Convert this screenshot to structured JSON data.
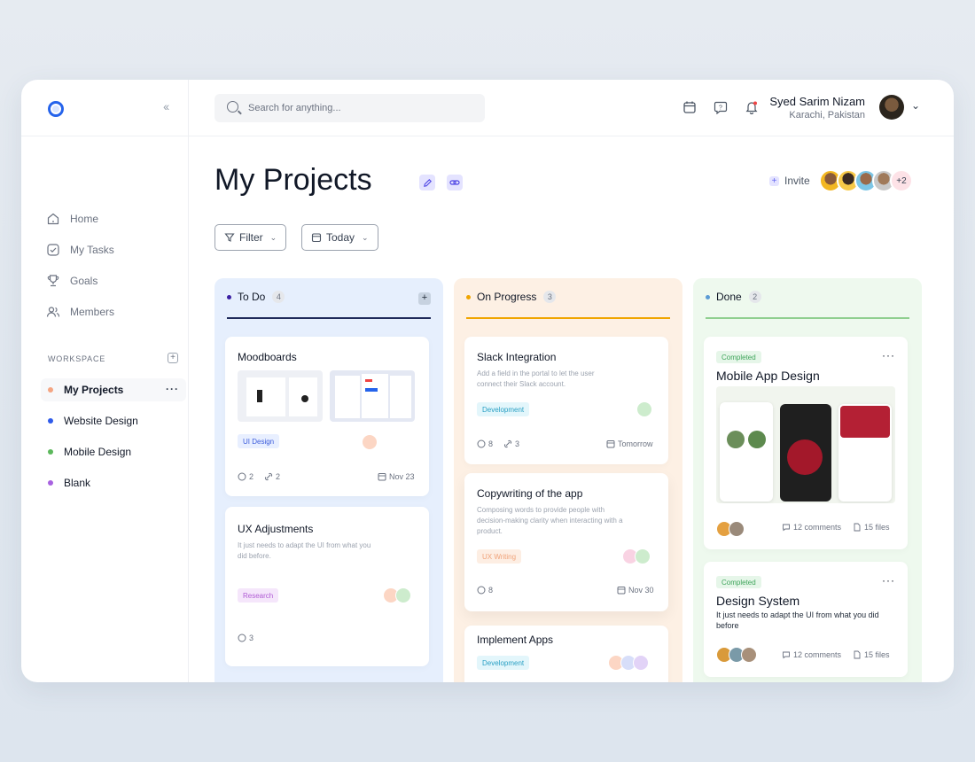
{
  "topbar": {
    "search_placeholder": "Search for anything...",
    "user_name": "Syed Sarim Nizam",
    "user_location": "Karachi, Pakistan"
  },
  "sidebar": {
    "nav": [
      {
        "label": "Home",
        "icon": "home-icon"
      },
      {
        "label": "My Tasks",
        "icon": "check-square-icon"
      },
      {
        "label": "Goals",
        "icon": "trophy-icon"
      },
      {
        "label": "Members",
        "icon": "users-icon"
      }
    ],
    "workspace_title": "WORKSPACE",
    "workspace_items": [
      {
        "label": "My Projects",
        "color": "#f4a582",
        "active": true
      },
      {
        "label": "Website Design",
        "color": "#2f5bea"
      },
      {
        "label": "Mobile Design",
        "color": "#5cb85c"
      },
      {
        "label": "Blank",
        "color": "#a862e0"
      }
    ]
  },
  "main": {
    "title": "My Projects",
    "invite_label": "Invite",
    "team_more": "+2",
    "filter_label": "Filter",
    "date_label": "Today"
  },
  "columns": [
    {
      "title": "To Do",
      "count": "4",
      "color": "#3b1fa3",
      "cards": [
        {
          "title": "Moodboards",
          "tag": "UI Design",
          "comments": "2",
          "links": "2",
          "date": "Nov 23"
        },
        {
          "title": "UX Adjustments",
          "desc": "It just needs to adapt the UI from what you did before.",
          "tag": "Research",
          "comments": "3"
        }
      ]
    },
    {
      "title": "On Progress",
      "count": "3",
      "color": "#f0a500",
      "cards": [
        {
          "title": "Slack Integration",
          "desc": "Add a field in the portal to let the user connect their Slack account.",
          "tag": "Development",
          "comments": "8",
          "links": "3",
          "date": "Tomorrow"
        },
        {
          "title": "Copywriting of the app",
          "desc": "Composing words to provide people with decision-making clarity when interacting with a product.",
          "tag": "UX Writing",
          "comments": "8",
          "date": "Nov 30"
        },
        {
          "title": "Implement Apps",
          "tag": "Development"
        }
      ]
    },
    {
      "title": "Done",
      "count": "2",
      "color": "#5b9bd5",
      "cards": [
        {
          "status": "Completed",
          "title": "Mobile App Design",
          "comments": "12 comments",
          "files": "15 files"
        },
        {
          "status": "Completed",
          "title": "Design System",
          "desc": "It just needs to adapt the UI from what you did before",
          "comments": "12 comments",
          "files": "15 files"
        }
      ]
    }
  ],
  "colors": {
    "accent": "#2563eb",
    "todo_bg": "#e6effd",
    "progress_bg": "#fdf0e4",
    "done_bg": "#eef9ee"
  }
}
